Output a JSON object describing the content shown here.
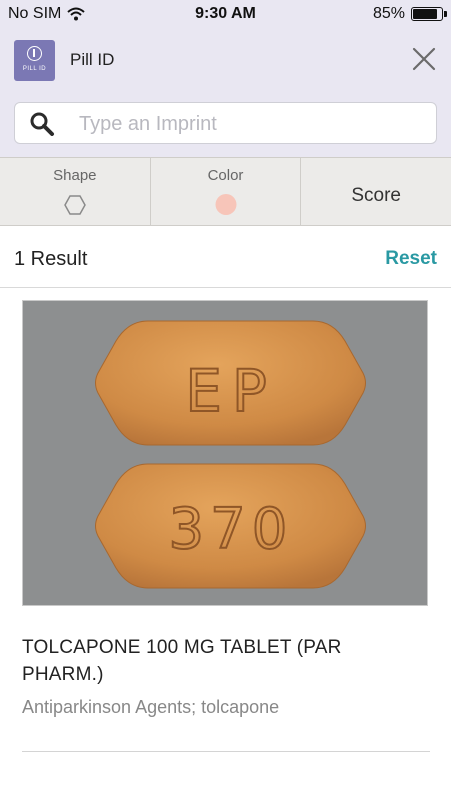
{
  "status_bar": {
    "carrier": "No SIM",
    "time": "9:30 AM",
    "battery": "85%",
    "battery_level": 0.85
  },
  "header": {
    "logo_text": "PILL ID",
    "title": "Pill ID",
    "close_icon": "close-icon"
  },
  "search": {
    "placeholder": "Type an Imprint",
    "value": "",
    "icon": "search-icon"
  },
  "filters": {
    "shape": {
      "label": "Shape",
      "icon": "hexagon-icon"
    },
    "color": {
      "label": "Color",
      "swatch": "#f7c5b9"
    },
    "score": {
      "label": "Score"
    }
  },
  "results": {
    "count_label": "1 Result",
    "reset_label": "Reset",
    "items": [
      {
        "image_imprints": [
          "EP",
          "370"
        ],
        "pill_color": "#d6944d",
        "title": "TOLCAPONE 100 MG TABLET (PAR PHARM.)",
        "subtitle": "Antiparkinson Agents; tolcapone"
      }
    ]
  },
  "colors": {
    "header_bg": "#e9e7f2",
    "logo_bg": "#7b78b4",
    "accent": "#2a99a3",
    "image_bg": "#8d8f90"
  }
}
